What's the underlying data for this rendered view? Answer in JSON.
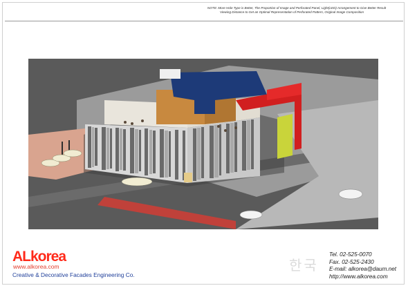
{
  "note": {
    "line1": "NOTE:  More Hole Type is Better,  The Proportion of Image and Perforated Panel,  Light(LED) Arrangement to Give Better Result",
    "line2": "Viewing Distance to Get an Optimal Representation of Perforated Pattern,  Original Image Composition"
  },
  "logo": {
    "brand": "ALkorea",
    "website": "www.alkorea.com",
    "tagline": "Creative & Decorative Facades Engineering Co."
  },
  "contact": {
    "tel": "Tel. 02-525-0070",
    "fax": "Fax. 02-525-2430",
    "email": "E-mail: alkorea@daum.net",
    "website": "http://www.alkorea.com"
  },
  "watermark": "한국",
  "colors": {
    "brand_red": "#ff2a1a",
    "tagline_blue": "#1f3f9a"
  }
}
